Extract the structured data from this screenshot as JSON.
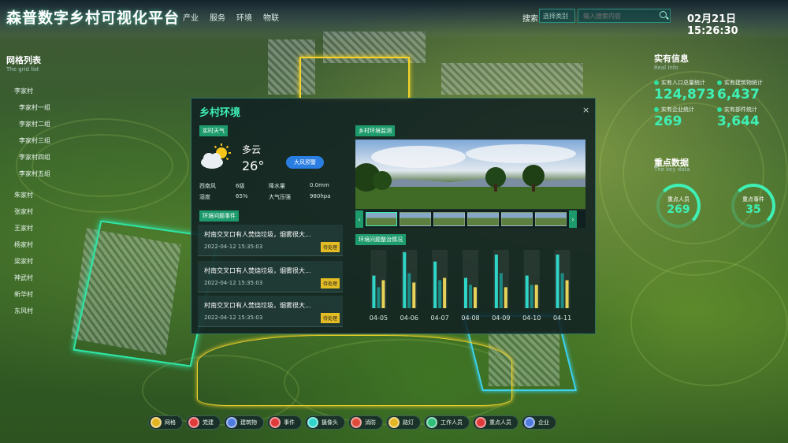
{
  "app": {
    "title": "森普数字乡村可视化平台",
    "nav": [
      "产业",
      "服务",
      "环境",
      "物联"
    ],
    "search": {
      "label": "搜索",
      "select_placeholder": "选择类别",
      "input_placeholder": "输入搜索内容"
    },
    "datetime": "02月21日 15:26:30"
  },
  "grid_list": {
    "title": "网格列表",
    "subtitle": "The grid list",
    "items": [
      "李家村",
      "李家村一组",
      "李家村二组",
      "李家村三组",
      "李家村四组",
      "李家村五组",
      "朱家村",
      "张家村",
      "王家村",
      "杨家村",
      "梁家村",
      "神武村",
      "新华村",
      "东风村"
    ]
  },
  "real_info": {
    "title": "实有信息",
    "subtitle": "Real Info",
    "stats": [
      {
        "label": "实有人口总量统计",
        "value": "124,873"
      },
      {
        "label": "实有建筑物统计",
        "value": "6,437"
      },
      {
        "label": "实有企业统计",
        "value": "269"
      },
      {
        "label": "实有部件统计",
        "value": "3,644"
      }
    ]
  },
  "key_data": {
    "title": "重点数据",
    "subtitle": "The key data",
    "rings": [
      {
        "label": "重点人员",
        "value": "269"
      },
      {
        "label": "重点事件",
        "value": "35"
      }
    ]
  },
  "modal": {
    "title": "乡村环境",
    "close": "×",
    "weather": {
      "tag": "实时天气",
      "condition": "多云",
      "temp": "26°",
      "alert_button": "大风预警",
      "table": [
        [
          "西南风",
          "6级",
          "降水量",
          "0.0mm"
        ],
        [
          "湿度",
          "65%",
          "大气压强",
          "980hpa"
        ]
      ]
    },
    "events": {
      "tag": "环境问题事件",
      "items": [
        {
          "text": "村南交叉口有人焚烧垃圾，烟雾很大...",
          "time": "2022-04-12  15:35:03",
          "status": "待处理"
        },
        {
          "text": "村南交叉口有人焚烧垃圾，烟雾很大...",
          "time": "2022-04-12  15:35:03",
          "status": "待处理"
        },
        {
          "text": "村南交叉口有人焚烧垃圾，烟雾很大...",
          "time": "2022-04-12  15:35:03",
          "status": "待处理"
        }
      ]
    },
    "monitor_tag": "乡村环境监测",
    "chart_tag": "环境问题整治情况"
  },
  "chart_data": {
    "type": "bar",
    "title": "环境问题整治情况",
    "categories": [
      "04-05",
      "04-06",
      "04-07",
      "04-08",
      "04-09",
      "04-10",
      "04-11"
    ],
    "series": [
      {
        "values": [
          28,
          48,
          40,
          26,
          46,
          28,
          46
        ],
        "color": "#2fd6c8"
      },
      {
        "values": [
          18,
          30,
          24,
          20,
          30,
          20,
          30
        ],
        "color": "#1e8c86"
      },
      {
        "values": [
          24,
          22,
          26,
          18,
          18,
          20,
          24
        ],
        "color": "#e8d35a"
      }
    ],
    "ylim": [
      0,
      50
    ],
    "legend": "none",
    "grid": false
  },
  "bottom_bar": [
    {
      "label": "网格",
      "icon": "grid-icon",
      "color": "#e4b522"
    },
    {
      "label": "党建",
      "icon": "party-icon",
      "color": "#e03a3a"
    },
    {
      "label": "建筑物",
      "icon": "building-icon",
      "color": "#4f7be0"
    },
    {
      "label": "事件",
      "icon": "alert-icon",
      "color": "#e03a3a"
    },
    {
      "label": "摄像头",
      "icon": "camera-icon",
      "color": "#2fd6c8"
    },
    {
      "label": "消防",
      "icon": "fire-icon",
      "color": "#e04a3a"
    },
    {
      "label": "路灯",
      "icon": "lamp-icon",
      "color": "#e4b522"
    },
    {
      "label": "工作人员",
      "icon": "staff-icon",
      "color": "#2fbf7a"
    },
    {
      "label": "重点人员",
      "icon": "person-icon",
      "color": "#e03a3a"
    },
    {
      "label": "企业",
      "icon": "enterprise-icon",
      "color": "#4f7be0"
    }
  ]
}
